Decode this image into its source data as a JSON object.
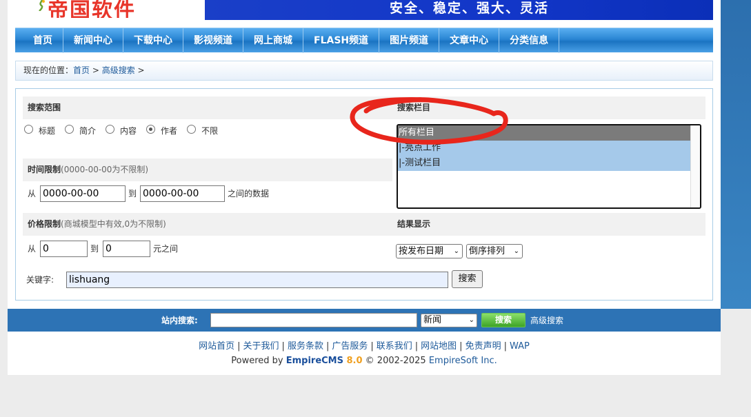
{
  "header": {
    "logo_text": "帝国软件",
    "slogan": "安全、稳定、强大、灵活"
  },
  "nav": {
    "items": [
      {
        "label": "首页"
      },
      {
        "label": "新闻中心"
      },
      {
        "label": "下载中心"
      },
      {
        "label": "影视频道"
      },
      {
        "label": "网上商城"
      },
      {
        "label": "FLASH频道"
      },
      {
        "label": "图片频道"
      },
      {
        "label": "文章中心"
      },
      {
        "label": "分类信息"
      }
    ]
  },
  "breadcrumb": {
    "prefix": "现在的位置：",
    "home": "首页",
    "sep1": " > ",
    "current": "高级搜索",
    "sep2": " >"
  },
  "search": {
    "scope": {
      "heading": "搜索范围",
      "options": [
        {
          "label": "标题",
          "checked": false
        },
        {
          "label": "简介",
          "checked": false
        },
        {
          "label": "内容",
          "checked": false
        },
        {
          "label": "作者",
          "checked": true
        },
        {
          "label": "不限",
          "checked": false
        }
      ]
    },
    "columns": {
      "heading": "搜索栏目",
      "options": [
        {
          "label": "所有栏目"
        },
        {
          "label": "|-亮点工作"
        },
        {
          "label": "|-测试栏目"
        }
      ]
    },
    "time": {
      "heading": "时间限制",
      "note": "(0000-00-00为不限制)",
      "from_label": "从",
      "from_value": "0000-00-00",
      "to_label": "到",
      "to_value": "0000-00-00",
      "suffix": "之间的数据"
    },
    "price": {
      "heading": "价格限制",
      "note": "(商城模型中有效,0为不限制)",
      "from_label": "从",
      "from_value": "0",
      "to_label": "到",
      "to_value": "0",
      "suffix": "元之间"
    },
    "results": {
      "heading": "结果显示",
      "order_by": "按发布日期",
      "order_dir": "倒序排列"
    },
    "keyword": {
      "label": "关键字:",
      "value": "lishuang",
      "button": "搜索"
    }
  },
  "site_search": {
    "label": "站内搜索:",
    "value": "",
    "category": "新闻",
    "button": "搜索",
    "advanced": "高级搜索"
  },
  "footer": {
    "links": [
      "网站首页",
      "关于我们",
      "服务条款",
      "广告服务",
      "联系我们",
      "网站地图",
      "免责声明",
      "WAP"
    ],
    "separator": "|",
    "powered_prefix": "Powered by ",
    "cms_name": "EmpireCMS",
    "cms_version": " 8.0",
    "copyright": "  © 2002-2025 ",
    "company": "EmpireSoft Inc."
  },
  "colors": {
    "nav_blue": "#2a86d4",
    "banner_blue": "#1236c8",
    "annotation_red": "#e8261c",
    "bar_blue": "#2d73b5"
  }
}
